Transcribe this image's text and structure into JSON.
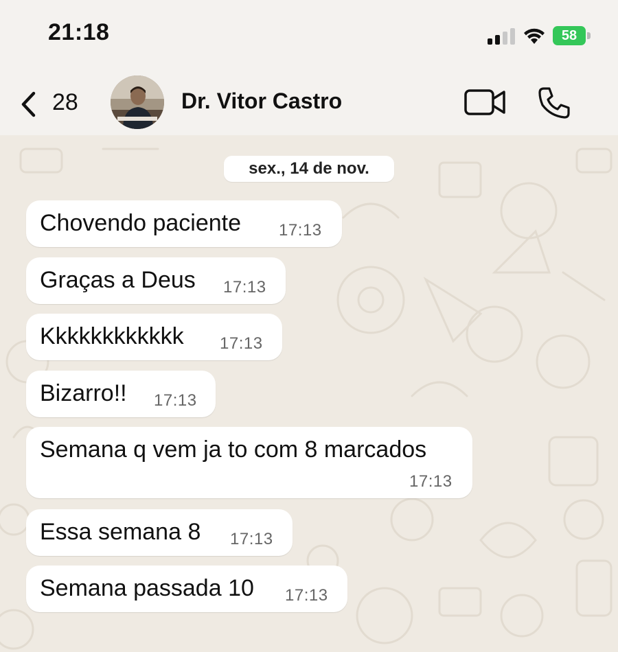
{
  "status_bar": {
    "time": "21:18",
    "battery_level": "58",
    "battery_color": "#34c759",
    "icons": [
      "cellular-signal-icon",
      "wifi-icon",
      "battery-charging-icon"
    ]
  },
  "header": {
    "back_count": "28",
    "contact_name": "Dr. Vitor Castro",
    "icons": [
      "back-chevron-icon",
      "video-call-icon",
      "phone-call-icon"
    ]
  },
  "chat": {
    "date_separator": "sex., 14 de nov.",
    "messages": [
      {
        "text": "Chovendo paciente",
        "time": "17:13"
      },
      {
        "text": "Graças a Deus",
        "time": "17:13"
      },
      {
        "text": "Kkkkkkkkkkkk",
        "time": "17:13"
      },
      {
        "text": "Bizarro!!",
        "time": "17:13"
      },
      {
        "text": "Semana q vem ja to com 8 marcados",
        "time": "17:13"
      },
      {
        "text": "Essa semana 8",
        "time": "17:13"
      },
      {
        "text": "Semana passada 10",
        "time": "17:13"
      }
    ]
  },
  "colors": {
    "chat_background": "#efeae2",
    "bubble_incoming": "#ffffff",
    "header_background": "#f4f2ef"
  }
}
